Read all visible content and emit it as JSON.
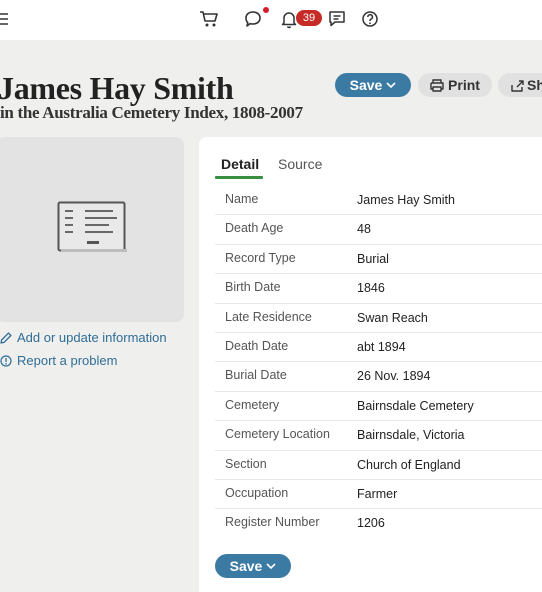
{
  "topbar": {
    "notification_count": "39",
    "icons": [
      "menu-icon",
      "cart-icon",
      "chat-icon",
      "bell-icon",
      "comment-icon",
      "help-icon"
    ],
    "alert_color": "#c62b27"
  },
  "record": {
    "title": "James Hay Smith",
    "subtitle": "in the Australia Cemetery Index, 1808-2007"
  },
  "actions": {
    "save_label": "Save",
    "print_label": "Print",
    "share_label": "Sh",
    "accent_color": "#3b7aa3"
  },
  "sidebar": {
    "add_update_label": "Add or update information",
    "report_label": "Report a problem"
  },
  "tabs": {
    "detail": "Detail",
    "source": "Source",
    "active": "Detail"
  },
  "details": [
    {
      "label": "Name",
      "value": "James Hay Smith"
    },
    {
      "label": "Death Age",
      "value": "48"
    },
    {
      "label": "Record Type",
      "value": "Burial"
    },
    {
      "label": "Birth Date",
      "value": "1846"
    },
    {
      "label": "Late Residence",
      "value": "Swan Reach"
    },
    {
      "label": "Death Date",
      "value": "abt 1894"
    },
    {
      "label": "Burial Date",
      "value": "26 Nov. 1894"
    },
    {
      "label": "Cemetery",
      "value": "Bairnsdale Cemetery"
    },
    {
      "label": "Cemetery Location",
      "value": "Bairnsdale, Victoria"
    },
    {
      "label": "Section",
      "value": "Church of England"
    },
    {
      "label": "Occupation",
      "value": "Farmer"
    },
    {
      "label": "Register Number",
      "value": "1206"
    }
  ]
}
